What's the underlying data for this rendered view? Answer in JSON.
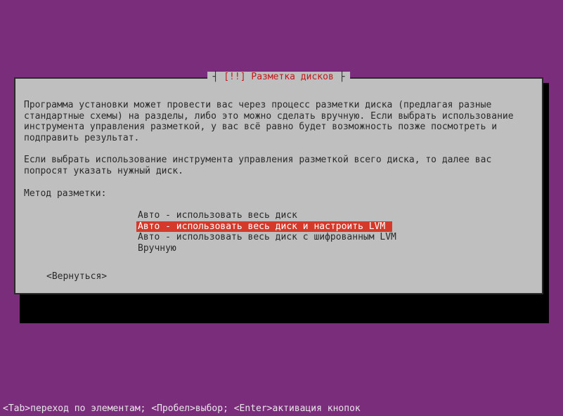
{
  "dialog": {
    "title_marker": "[!!]",
    "title_text": "Разметка дисков",
    "paragraph1": "Программа установки может провести вас через процесс разметки диска (предлагая разные стандартные схемы) на разделы, либо это можно сделать вручную. Если выбрать использование инструмента управления разметкой, у вас всё равно будет возможность позже посмотреть и подправить результат.",
    "paragraph2": "Если выбрать использование инструмента управления разметкой всего диска, то далее вас попросят указать нужный диск.",
    "prompt": "Метод разметки:",
    "options": [
      "Авто - использовать весь диск",
      "Авто - использовать весь диск и настроить LVM",
      "Авто - использовать весь диск с шифрованным LVM",
      "Вручную"
    ],
    "selected_index": 1,
    "back_label": "<Вернуться>"
  },
  "helpbar": "<Tab>переход по элементам; <Пробел>выбор; <Enter>активация кнопок"
}
